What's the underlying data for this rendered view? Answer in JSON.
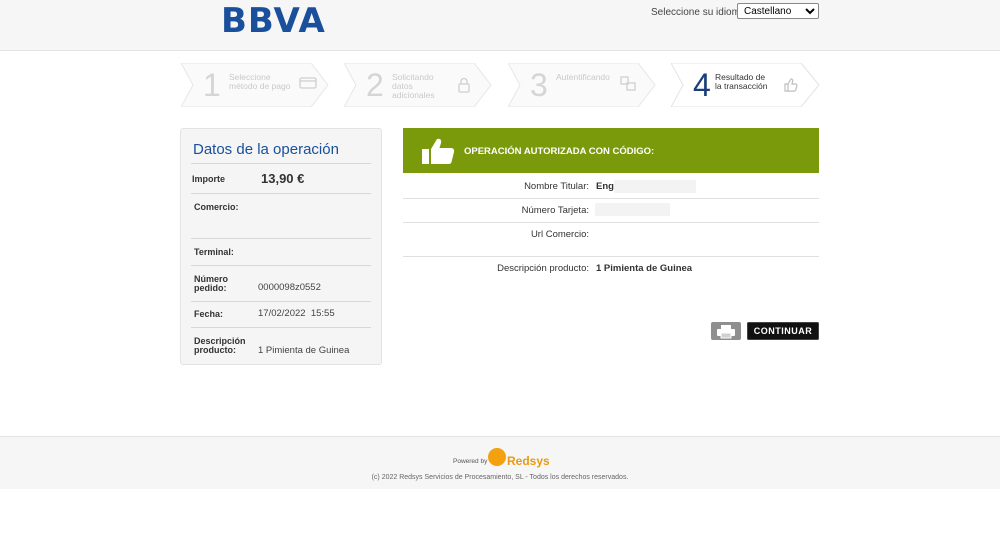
{
  "header": {
    "logo": "BBVA",
    "language_label": "Seleccione su idioma",
    "language_selected": "Castellano"
  },
  "steps": [
    {
      "number": "1",
      "label": "Seleccione método de pago"
    },
    {
      "number": "2",
      "label": "Solicitando datos adicionales"
    },
    {
      "number": "3",
      "label": "Autentificando"
    },
    {
      "number": "4",
      "label": "Resultado de la transacción"
    }
  ],
  "operation": {
    "title": "Datos de la operación",
    "importe_label": "Importe",
    "importe_value": "13,90 €",
    "comercio_label": "Comercio:",
    "terminal_label": "Terminal:",
    "pedido_label": "Número pedido:",
    "pedido_value": "0000098z0552",
    "fecha_label": "Fecha:",
    "fecha_value": "17/02/2022  15:55",
    "descripcion_label": "Descripción producto:",
    "descripcion_value": "1 Pimienta de Guinea"
  },
  "result": {
    "status": "OPERACIÓN AUTORIZADA CON CÓDIGO:",
    "titular_label": "Nombre Titular:",
    "titular_value": "Eng",
    "tarjeta_label": "Número Tarjeta:",
    "url_label": "Url Comercio:",
    "descripcion_label": "Descripción producto:",
    "descripcion_value": "1 Pimienta de Guinea"
  },
  "actions": {
    "continue_label": "CONTINUAR"
  },
  "footer": {
    "powered_by": "Powered by",
    "brand": "Redsys",
    "copyright": "(c) 2022 Redsys Servicios de Procesamiento, SL - Todos los derechos reservados."
  },
  "colors": {
    "brand_blue": "#1a4f9c",
    "success_green": "#7a9a0c",
    "redsys_orange": "#f3a10f"
  }
}
